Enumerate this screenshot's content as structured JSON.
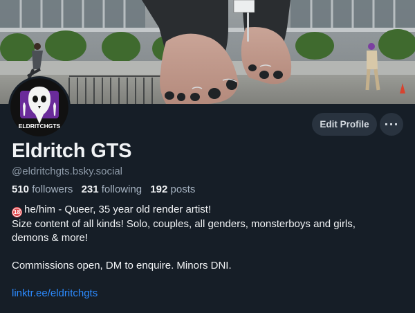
{
  "profile": {
    "avatar_text": "ELDRITCHGTS",
    "display_name": "Eldritch GTS",
    "handle": "@eldritchgts.bsky.social",
    "stats": {
      "followers_count": "510",
      "followers_label": "followers",
      "following_count": "231",
      "following_label": "following",
      "posts_count": "192",
      "posts_label": "posts"
    },
    "bio": {
      "line1": "he/him - Queer, 35 year old render artist!",
      "badge": "18",
      "line2": "Size content of all kinds! Solo, couples, all genders, monsterboys and girls,",
      "line3": "demons & more!",
      "line4": "Commissions open, DM to enquire. Minors DNI.",
      "link": "linktr.ee/eldritchgts"
    }
  },
  "actions": {
    "edit_profile_label": "Edit Profile",
    "more_label": "···"
  },
  "icons": {
    "more": "more-horizontal-icon",
    "age_badge": "age-18-badge-icon"
  },
  "colors": {
    "background": "#161e27",
    "button_bg": "#29333f",
    "link": "#2c8bff",
    "muted_text": "#8d9aa8"
  }
}
